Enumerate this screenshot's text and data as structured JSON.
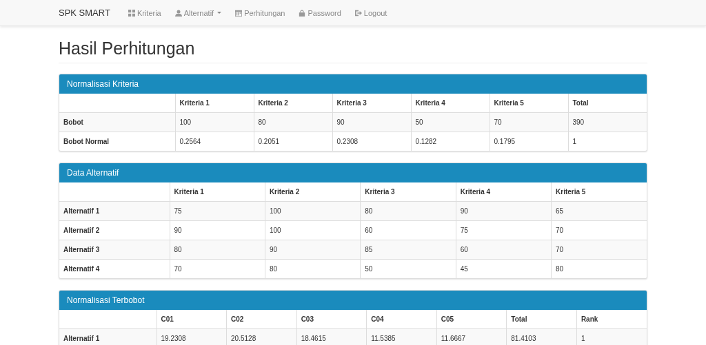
{
  "navbar": {
    "brand": "SPK SMART",
    "items": [
      {
        "label": "Kriteria",
        "kind": "grid",
        "dropdown": false
      },
      {
        "label": "Alternatif",
        "kind": "user",
        "dropdown": true
      },
      {
        "label": "Perhitungan",
        "kind": "calendar",
        "dropdown": false
      },
      {
        "label": "Password",
        "kind": "lock",
        "dropdown": false
      },
      {
        "label": "Logout",
        "kind": "logout",
        "dropdown": false
      }
    ]
  },
  "page_title": "Hasil Perhitungan",
  "panels": [
    {
      "title": "Normalisasi Kriteria",
      "columns": [
        "Kriteria 1",
        "Kriteria 2",
        "Kriteria 3",
        "Kriteria 4",
        "Kriteria 5",
        "Total"
      ],
      "rows": [
        {
          "label": "Bobot",
          "cells": [
            "100",
            "80",
            "90",
            "50",
            "70",
            "390"
          ]
        },
        {
          "label": "Bobot Normal",
          "cells": [
            "0.2564",
            "0.2051",
            "0.2308",
            "0.1282",
            "0.1795",
            "1"
          ]
        }
      ]
    },
    {
      "title": "Data Alternatif",
      "columns": [
        "Kriteria 1",
        "Kriteria 2",
        "Kriteria 3",
        "Kriteria 4",
        "Kriteria 5"
      ],
      "rows": [
        {
          "label": "Alternatif 1",
          "cells": [
            "75",
            "100",
            "80",
            "90",
            "65"
          ]
        },
        {
          "label": "Alternatif 2",
          "cells": [
            "90",
            "100",
            "60",
            "75",
            "70"
          ]
        },
        {
          "label": "Alternatif 3",
          "cells": [
            "80",
            "90",
            "85",
            "60",
            "70"
          ]
        },
        {
          "label": "Alternatif 4",
          "cells": [
            "70",
            "80",
            "50",
            "45",
            "80"
          ]
        }
      ]
    },
    {
      "title": "Normalisasi Terbobot",
      "columns": [
        "C01",
        "C02",
        "C03",
        "C04",
        "C05",
        "Total",
        "Rank"
      ],
      "rows": [
        {
          "label": "Alternatif 1",
          "cells": [
            "19.2308",
            "20.5128",
            "18.4615",
            "11.5385",
            "11.6667",
            "81.4103",
            "1"
          ]
        }
      ]
    }
  ]
}
